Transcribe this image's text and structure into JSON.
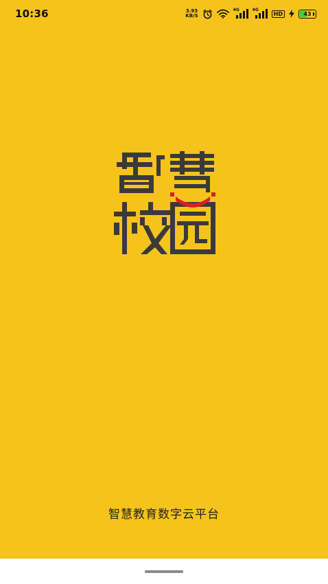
{
  "status_bar": {
    "time": "10:36",
    "net_speed_value": "3.93",
    "net_speed_unit": "KB/S",
    "sim1_tag": "4G",
    "sim2_tag": "4G",
    "hd_label": "HD",
    "battery_level": "43",
    "icons": [
      "alarm-icon",
      "wifi-icon",
      "signal-icon",
      "signal-icon",
      "hd-icon",
      "charging-icon",
      "battery-icon"
    ]
  },
  "logo": {
    "line1": "智慧",
    "line2": "校园",
    "colors": {
      "primary": "#3A3A3A",
      "accent": "#D4241C"
    }
  },
  "slogan": "智慧教育数字云平台",
  "theme": {
    "background": "#F5C31C",
    "nav_bar": "#FFFFFF",
    "battery_fill": "#3FCB46"
  }
}
